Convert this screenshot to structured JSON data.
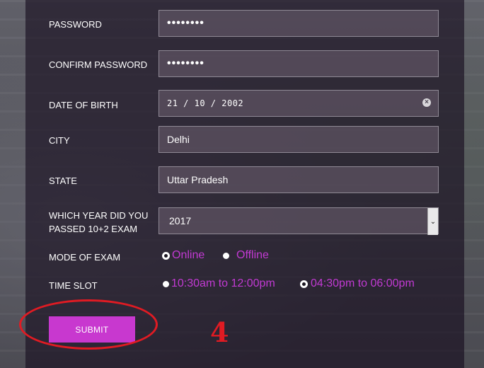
{
  "form": {
    "password": {
      "label": "PASSWORD",
      "value": "••••••••"
    },
    "confirm_password": {
      "label": "CONFIRM PASSWORD",
      "value": "••••••••"
    },
    "dob": {
      "label": "DATE OF BIRTH",
      "value": "21 / 10 / 2002",
      "clear_icon": "×"
    },
    "city": {
      "label": "CITY",
      "value": "Delhi"
    },
    "state": {
      "label": "STATE",
      "value": "Uttar Pradesh"
    },
    "year": {
      "label_line1": "WHICH YEAR DID YOU",
      "label_line2": "PASSED 10+2 EXAM",
      "value": "2017",
      "arrow": "⌄"
    },
    "mode": {
      "label": "MODE OF EXAM",
      "options": [
        "Online",
        "Offline"
      ],
      "selected": "Online"
    },
    "time_slot": {
      "label": "TIME SLOT",
      "options": [
        "10:30am to 12:00pm",
        "04:30pm to 06:00pm"
      ],
      "selected": "04:30pm to 06:00pm"
    },
    "submit_label": "SUBMIT"
  },
  "annotation": {
    "step_number": "4",
    "color": "#e01b23"
  },
  "colors": {
    "accent": "#c838cf",
    "radio_text": "#c23ad3"
  }
}
